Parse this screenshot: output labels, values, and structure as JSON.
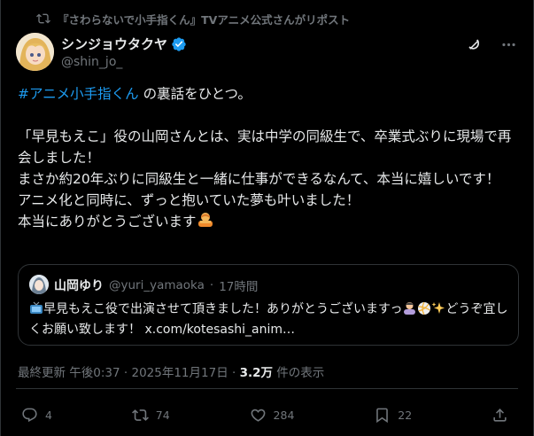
{
  "repost_banner": {
    "text": "『さわらないで小手指くん』TVアニメ公式さんがリポスト"
  },
  "author": {
    "display_name": "シンジョウタクヤ",
    "handle": "@shin_jo_"
  },
  "tweet": {
    "hashtag": "#アニメ小手指くん",
    "line1_rest": " の裏話をひとつ。",
    "paragraph": "「早見もえこ」役の山岡さんとは、実は中学の同級生で、卒業式ぶりに現場で再会しました！\nまさか約20年ぶりに同級生と一緒に仕事ができるなんて、本当に嬉しいです！\nアニメ化と同時に、ずっと抱いていた夢も叶いました！\n本当にありがとうございます"
  },
  "quote": {
    "display_name": "山岡ゆり",
    "handle": "@yuri_yamaoka",
    "separator": "·",
    "time": "17時間",
    "text": "早見もえこ役で出演させて頂きました！ありがとうございますっ",
    "text2": "どうぞ宜しくお願い致します！ ",
    "link": "x.com/kotesashi_anim…"
  },
  "meta": {
    "prefix": "最終更新 午後0:37 · 2025年11月17日 · ",
    "views_count": "3.2万",
    "views_suffix": " 件の表示"
  },
  "actions": {
    "replies": "4",
    "reposts": "74",
    "likes": "284",
    "bookmarks": "22"
  },
  "colors": {
    "accent": "#1d9bf0",
    "muted": "#71767b",
    "text": "#e7e9ea",
    "background": "#000000",
    "border": "#2f3336"
  },
  "icons": [
    "repost-icon",
    "verified-badge-icon",
    "grok-icon",
    "more-icon",
    "reply-icon",
    "retweet-icon",
    "like-icon",
    "bookmark-icon",
    "share-icon"
  ]
}
